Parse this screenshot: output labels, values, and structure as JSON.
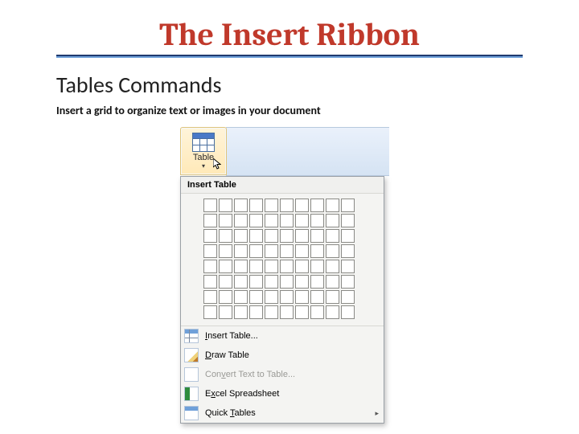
{
  "title": "The Insert Ribbon",
  "subtitle": "Tables Commands",
  "description": "Insert a grid to organize text or images in your document",
  "grid": {
    "cols": 10,
    "rows": 8
  },
  "ribbon": {
    "table_button": "Table"
  },
  "dropdown": {
    "header": "Insert Table",
    "items": [
      {
        "key": "insert",
        "label_pre": "",
        "hot": "I",
        "label_post": "nsert Table...",
        "icon": "grid",
        "enabled": true,
        "submenu": false
      },
      {
        "key": "draw",
        "label_pre": "",
        "hot": "D",
        "label_post": "raw Table",
        "icon": "pencil",
        "enabled": true,
        "submenu": false
      },
      {
        "key": "convert",
        "label_pre": "Con",
        "hot": "v",
        "label_post": "ert Text to Table...",
        "icon": "text",
        "enabled": false,
        "submenu": false
      },
      {
        "key": "excel",
        "label_pre": "E",
        "hot": "x",
        "label_post": "cel Spreadsheet",
        "icon": "excel",
        "enabled": true,
        "submenu": false
      },
      {
        "key": "quick",
        "label_pre": "Quick ",
        "hot": "T",
        "label_post": "ables",
        "icon": "quick",
        "enabled": true,
        "submenu": true
      }
    ]
  }
}
